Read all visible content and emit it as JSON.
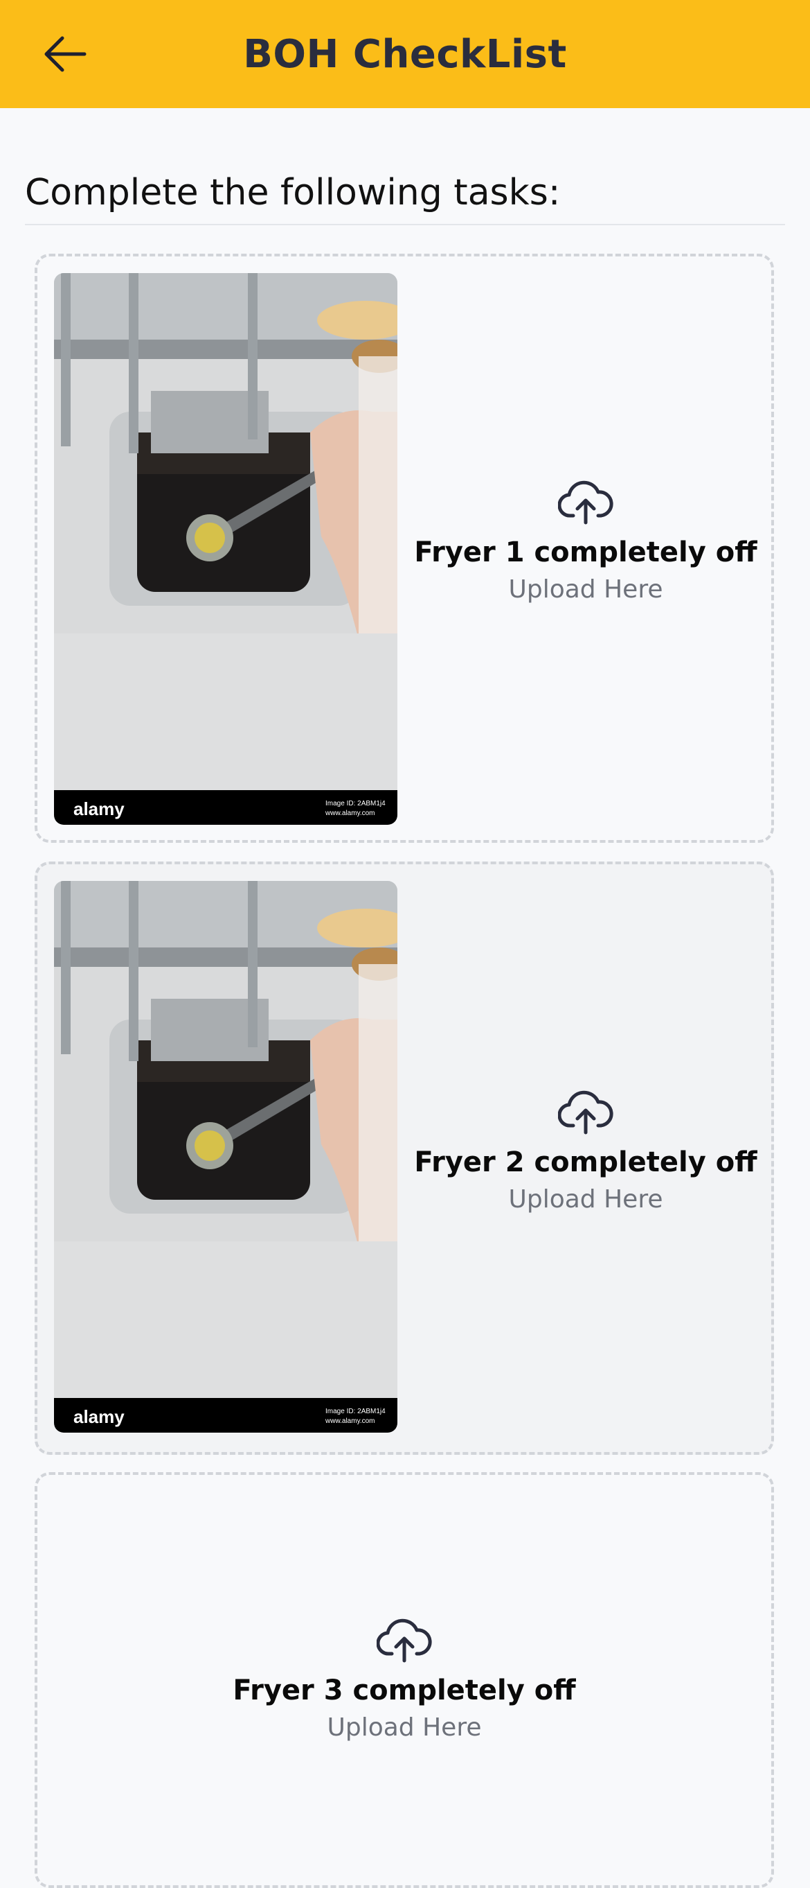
{
  "header": {
    "title": "BOH CheckList",
    "back_icon": "arrow-left-icon",
    "background": "#fbbd18"
  },
  "section": {
    "title": "Complete the following tasks:"
  },
  "tasks": [
    {
      "label": "Fryer 1 completely off",
      "hint": "Upload Here",
      "has_photo": true,
      "photo_watermark": "alamy",
      "photo_caption_1": "Image ID: 2ABM1j4",
      "photo_caption_2": "www.alamy.com"
    },
    {
      "label": "Fryer 2 completely off",
      "hint": "Upload Here",
      "has_photo": true,
      "photo_watermark": "alamy",
      "photo_caption_1": "Image ID: 2ABM1j4",
      "photo_caption_2": "www.alamy.com"
    },
    {
      "label": "Fryer 3 completely off",
      "hint": "Upload Here",
      "has_photo": false
    }
  ],
  "icons": {
    "upload": "cloud-upload-icon"
  }
}
